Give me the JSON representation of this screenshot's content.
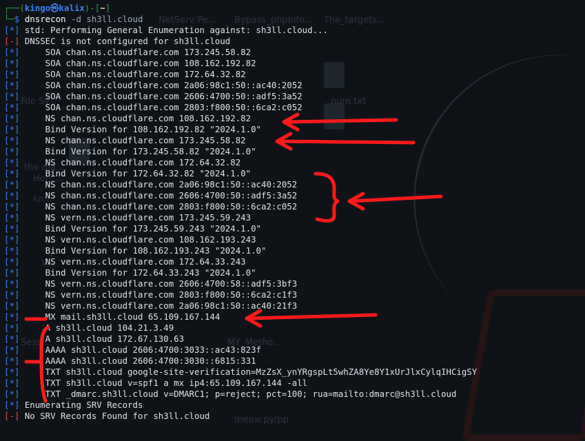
{
  "prompt": {
    "user": "kingo",
    "symbol": "㉿",
    "host": "kalix",
    "dir": "~",
    "command": "dnsrecon",
    "args": "-d sh3ll.cloud"
  },
  "lines": [
    {
      "mark": "*",
      "text": "std: Performing General Enumeration against: sh3ll.cloud..."
    },
    {
      "mark": "-",
      "text": "DNSSEC is not configured for sh3ll.cloud"
    },
    {
      "mark": "*",
      "text": "    SOA chan.ns.cloudflare.com 173.245.58.82"
    },
    {
      "mark": "*",
      "text": "    SOA chan.ns.cloudflare.com 108.162.192.82"
    },
    {
      "mark": "*",
      "text": "    SOA chan.ns.cloudflare.com 172.64.32.82"
    },
    {
      "mark": "*",
      "text": "    SOA chan.ns.cloudflare.com 2a06:98c1:50::ac40:2052"
    },
    {
      "mark": "*",
      "text": "    SOA chan.ns.cloudflare.com 2606:4700:50::adf5:3a52"
    },
    {
      "mark": "*",
      "text": "    SOA chan.ns.cloudflare.com 2803:f800:50::6ca2:c052"
    },
    {
      "mark": "*",
      "text": "    NS chan.ns.cloudflare.com 108.162.192.82"
    },
    {
      "mark": "*",
      "text": "    Bind Version for 108.162.192.82 \"2024.1.0\""
    },
    {
      "mark": "*",
      "text": "    NS chan.ns.cloudflare.com 173.245.58.82"
    },
    {
      "mark": "*",
      "text": "    Bind Version for 173.245.58.82 \"2024.1.0\""
    },
    {
      "mark": "*",
      "text": "    NS chan.ns.cloudflare.com 172.64.32.82"
    },
    {
      "mark": "*",
      "text": "    Bind Version for 172.64.32.82 \"2024.1.0\""
    },
    {
      "mark": "*",
      "text": "    NS chan.ns.cloudflare.com 2a06:98c1:50::ac40:2052"
    },
    {
      "mark": "*",
      "text": "    NS chan.ns.cloudflare.com 2606:4700:50::adf5:3a52"
    },
    {
      "mark": "*",
      "text": "    NS chan.ns.cloudflare.com 2803:f800:50::6ca2:c052"
    },
    {
      "mark": "*",
      "text": "    NS vern.ns.cloudflare.com 173.245.59.243"
    },
    {
      "mark": "*",
      "text": "    Bind Version for 173.245.59.243 \"2024.1.0\""
    },
    {
      "mark": "*",
      "text": "    NS vern.ns.cloudflare.com 108.162.193.243"
    },
    {
      "mark": "*",
      "text": "    Bind Version for 108.162.193.243 \"2024.1.0\""
    },
    {
      "mark": "*",
      "text": "    NS vern.ns.cloudflare.com 172.64.33.243"
    },
    {
      "mark": "*",
      "text": "    Bind Version for 172.64.33.243 \"2024.1.0\""
    },
    {
      "mark": "*",
      "text": "    NS vern.ns.cloudflare.com 2606:4700:58::adf5:3bf3"
    },
    {
      "mark": "*",
      "text": "    NS vern.ns.cloudflare.com 2803:f800:50::6ca2:c1f3"
    },
    {
      "mark": "*",
      "text": "    NS vern.ns.cloudflare.com 2a06:98c1:50::ac40:21f3"
    },
    {
      "mark": "*",
      "text": "    MX mail.sh3ll.cloud 65.109.167.144"
    },
    {
      "mark": "*",
      "text": "    A sh3ll.cloud 104.21.3.49"
    },
    {
      "mark": "*",
      "text": "    A sh3ll.cloud 172.67.130.63"
    },
    {
      "mark": "*",
      "text": "    AAAA sh3ll.cloud 2606:4700:3033::ac43:823f"
    },
    {
      "mark": "*",
      "text": "    AAAA sh3ll.cloud 2606:4700:3030::6815:331"
    },
    {
      "mark": "*",
      "text": "    TXT sh3ll.cloud google-site-verification=MzZsX_ynYRgspLt5whZA8Ye8Y1xUrJlxCylqIHCigSY"
    },
    {
      "mark": "*",
      "text": "    TXT sh3ll.cloud v=spf1 a mx ip4:65.109.167.144 -all"
    },
    {
      "mark": "*",
      "text": "    TXT _dmarc.sh3ll.cloud v=DMARC1; p=reject; pct=100; rua=mailto:dmarc@sh3ll.cloud"
    },
    {
      "mark": "*",
      "text": "Enumerating SRV Records"
    },
    {
      "mark": "-",
      "text": "No SRV Records Found for sh3ll.cloud"
    }
  ],
  "colors": {
    "info_bracket": "#3b82f6",
    "error_bracket": "#e5484d",
    "annotation": "#ff1a1a"
  },
  "wallpaper": {
    "labels": [
      "NetServ Pe...",
      "Bypass_phpinfo...",
      "The_targets...",
      "File Sy...",
      "num.txt",
      "the ma...",
      "Hom...",
      "kn...",
      "V...",
      "Sessi...",
      "MY_Metho...",
      "meow.py/pp"
    ]
  }
}
